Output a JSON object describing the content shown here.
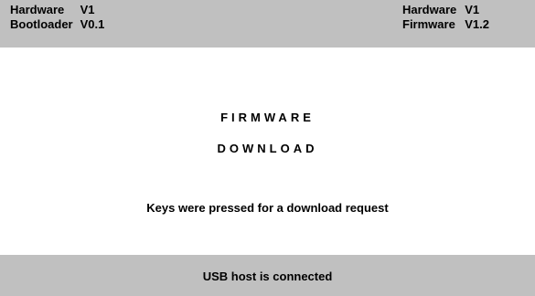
{
  "header": {
    "left": [
      {
        "label": "Hardware",
        "value": "V1"
      },
      {
        "label": "Bootloader",
        "value": "V0.1"
      }
    ],
    "right": [
      {
        "label": "Hardware",
        "value": "V1"
      },
      {
        "label": "Firmware",
        "value": "V1.2"
      }
    ]
  },
  "main": {
    "title_line1": "FIRMWARE",
    "title_line2": "DOWNLOAD",
    "message": "Keys were pressed for a download request"
  },
  "status_bar": {
    "text": "USB host is connected"
  },
  "colors": {
    "panel_background": "#c0c0c0",
    "screen_background": "#ffffff",
    "text": "#000000"
  }
}
